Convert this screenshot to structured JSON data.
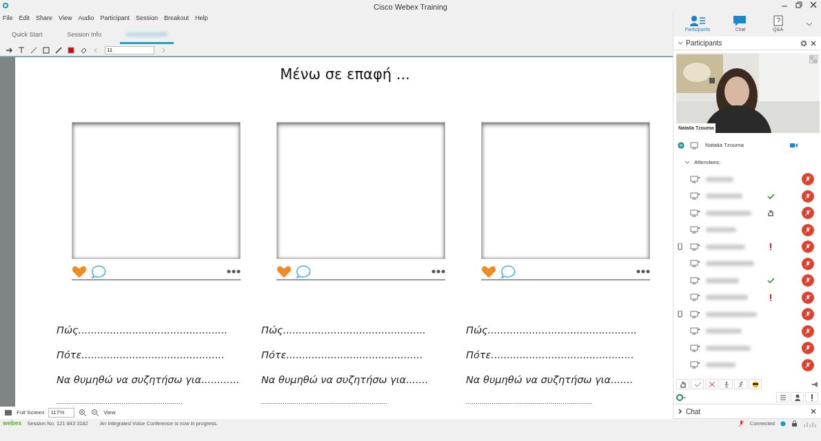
{
  "window": {
    "title": "Cisco Webex Training"
  },
  "menu": [
    "File",
    "Edit",
    "Share",
    "View",
    "Audio",
    "Participant",
    "Session",
    "Breakout",
    "Help"
  ],
  "tabs": [
    {
      "kind": "text",
      "label": "Quick Start",
      "selected": false
    },
    {
      "kind": "text",
      "label": "Session Info",
      "selected": false
    },
    {
      "kind": "redacted",
      "selected": true
    }
  ],
  "toolbar": {
    "page_field": "11"
  },
  "slide": {
    "title": "Μένω σε επαφή ...",
    "cards": [
      {
        "lines": [
          "Πώς...............................................",
          "Πότε.............................................",
          "Να θυμηθώ να συζητήσω για............",
          "................................................................"
        ]
      },
      {
        "lines": [
          "Πώς.............................................",
          "Πότε...........................................",
          "Να θυμηθώ να συζητήσω για.......",
          "................................................................"
        ]
      },
      {
        "lines": [
          "Πώς...............................................",
          "Πότε.............................................",
          "Να θυμηθώ να συζητήσω για.......",
          "................................................................"
        ]
      }
    ]
  },
  "panel_tabs": [
    {
      "label": "Participants",
      "selected": true
    },
    {
      "label": "Chat",
      "selected": false
    },
    {
      "label": "Q&A",
      "selected": false
    }
  ],
  "participants": {
    "title": "Participants",
    "video_caption": "Natalia Tzouma",
    "host": "Natalia Tzouma",
    "group": "Attendees:",
    "attendees": [
      {
        "agreed": false,
        "hand_raised": false,
        "alert": false,
        "mobile": false
      },
      {
        "agreed": true,
        "hand_raised": false,
        "alert": false,
        "mobile": false
      },
      {
        "agreed": false,
        "hand_raised": true,
        "alert": false,
        "mobile": false
      },
      {
        "agreed": false,
        "hand_raised": false,
        "alert": false,
        "mobile": false
      },
      {
        "agreed": false,
        "hand_raised": false,
        "alert": true,
        "mobile": true
      },
      {
        "agreed": false,
        "hand_raised": false,
        "alert": false,
        "mobile": false
      },
      {
        "agreed": true,
        "hand_raised": false,
        "alert": false,
        "mobile": false
      },
      {
        "agreed": false,
        "hand_raised": false,
        "alert": true,
        "mobile": false
      },
      {
        "agreed": false,
        "hand_raised": false,
        "alert": false,
        "mobile": true
      },
      {
        "agreed": false,
        "hand_raised": false,
        "alert": false,
        "mobile": false
      },
      {
        "agreed": false,
        "hand_raised": false,
        "alert": false,
        "mobile": false
      },
      {
        "agreed": false,
        "hand_raised": false,
        "alert": false,
        "mobile": false
      }
    ]
  },
  "chat": {
    "title": "Chat",
    "expanded": false
  },
  "bottom_bar": {
    "full_screen": "Full Screen",
    "zoom": "117%",
    "view": "View"
  },
  "status_bar": {
    "logo": "webex",
    "session": "Session No. 121 843 3182",
    "message": "An Integrated Voice Conference is now in progress.",
    "connection": "Connected"
  }
}
